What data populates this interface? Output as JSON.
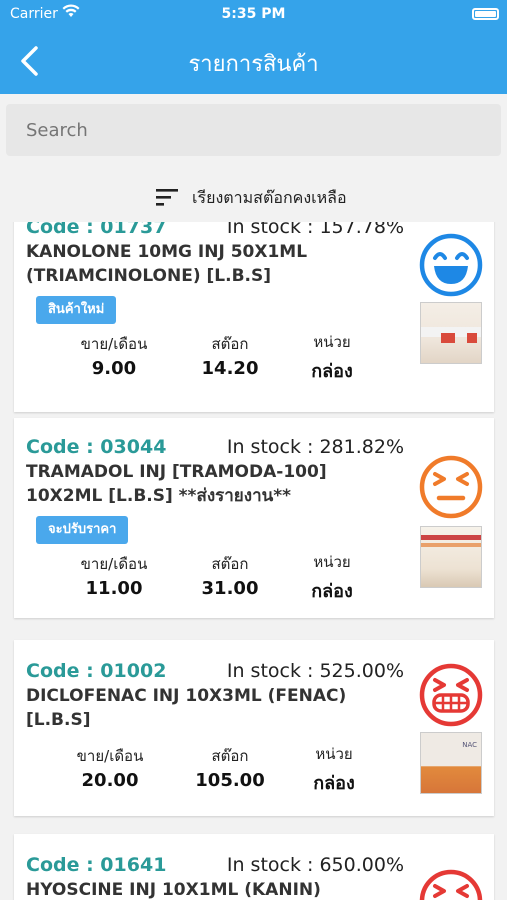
{
  "status_bar": {
    "carrier": "Carrier",
    "time": "5:35 PM"
  },
  "nav": {
    "title": "รายการสินค้า"
  },
  "search": {
    "placeholder": "Search"
  },
  "sort": {
    "label": "เรียงตามสต๊อกคงเหลือ"
  },
  "products": [
    {
      "code": "Code : 01737",
      "stock": "In stock : 157.78%",
      "name": "KANOLONE 10MG INJ 50X1ML (TRIAMCINOLONE) [L.B.S]",
      "tag": "สินค้าใหม่",
      "sales_label": "ขาย/เดือน",
      "sales": "9.00",
      "stock_label": "สต๊อก",
      "stock_value": "14.20",
      "unit_label": "หน่วย",
      "unit": "กล่อง",
      "face": "happy-face-icon",
      "face_color": "#1e88e5"
    },
    {
      "code": "Code : 03044",
      "stock": "In stock : 281.82%",
      "name": "TRAMADOL INJ [TRAMODA-100] 10X2ML [L.B.S]  **ส่งรายงาน**",
      "tag": "จะปรับราคา",
      "sales_label": "ขาย/เดือน",
      "sales": "11.00",
      "stock_label": "สต๊อก",
      "stock_value": "31.00",
      "unit_label": "หน่วย",
      "unit": "กล่อง",
      "face": "annoyed-face-icon",
      "face_color": "#f07b2a"
    },
    {
      "code": "Code : 01002",
      "stock": "In stock : 525.00%",
      "name": "DICLOFENAC INJ 10X3ML (FENAC) [L.B.S]",
      "sales_label": "ขาย/เดือน",
      "sales": "20.00",
      "stock_label": "สต๊อก",
      "stock_value": "105.00",
      "unit_label": "หน่วย",
      "unit": "กล่อง",
      "face": "angry-face-icon",
      "face_color": "#e53935"
    },
    {
      "code": "Code : 01641",
      "stock": "In stock : 650.00%",
      "name": "HYOSCINE INJ  10X1ML (KANIN)",
      "face": "angry-face-icon",
      "face_color": "#e53935"
    }
  ]
}
